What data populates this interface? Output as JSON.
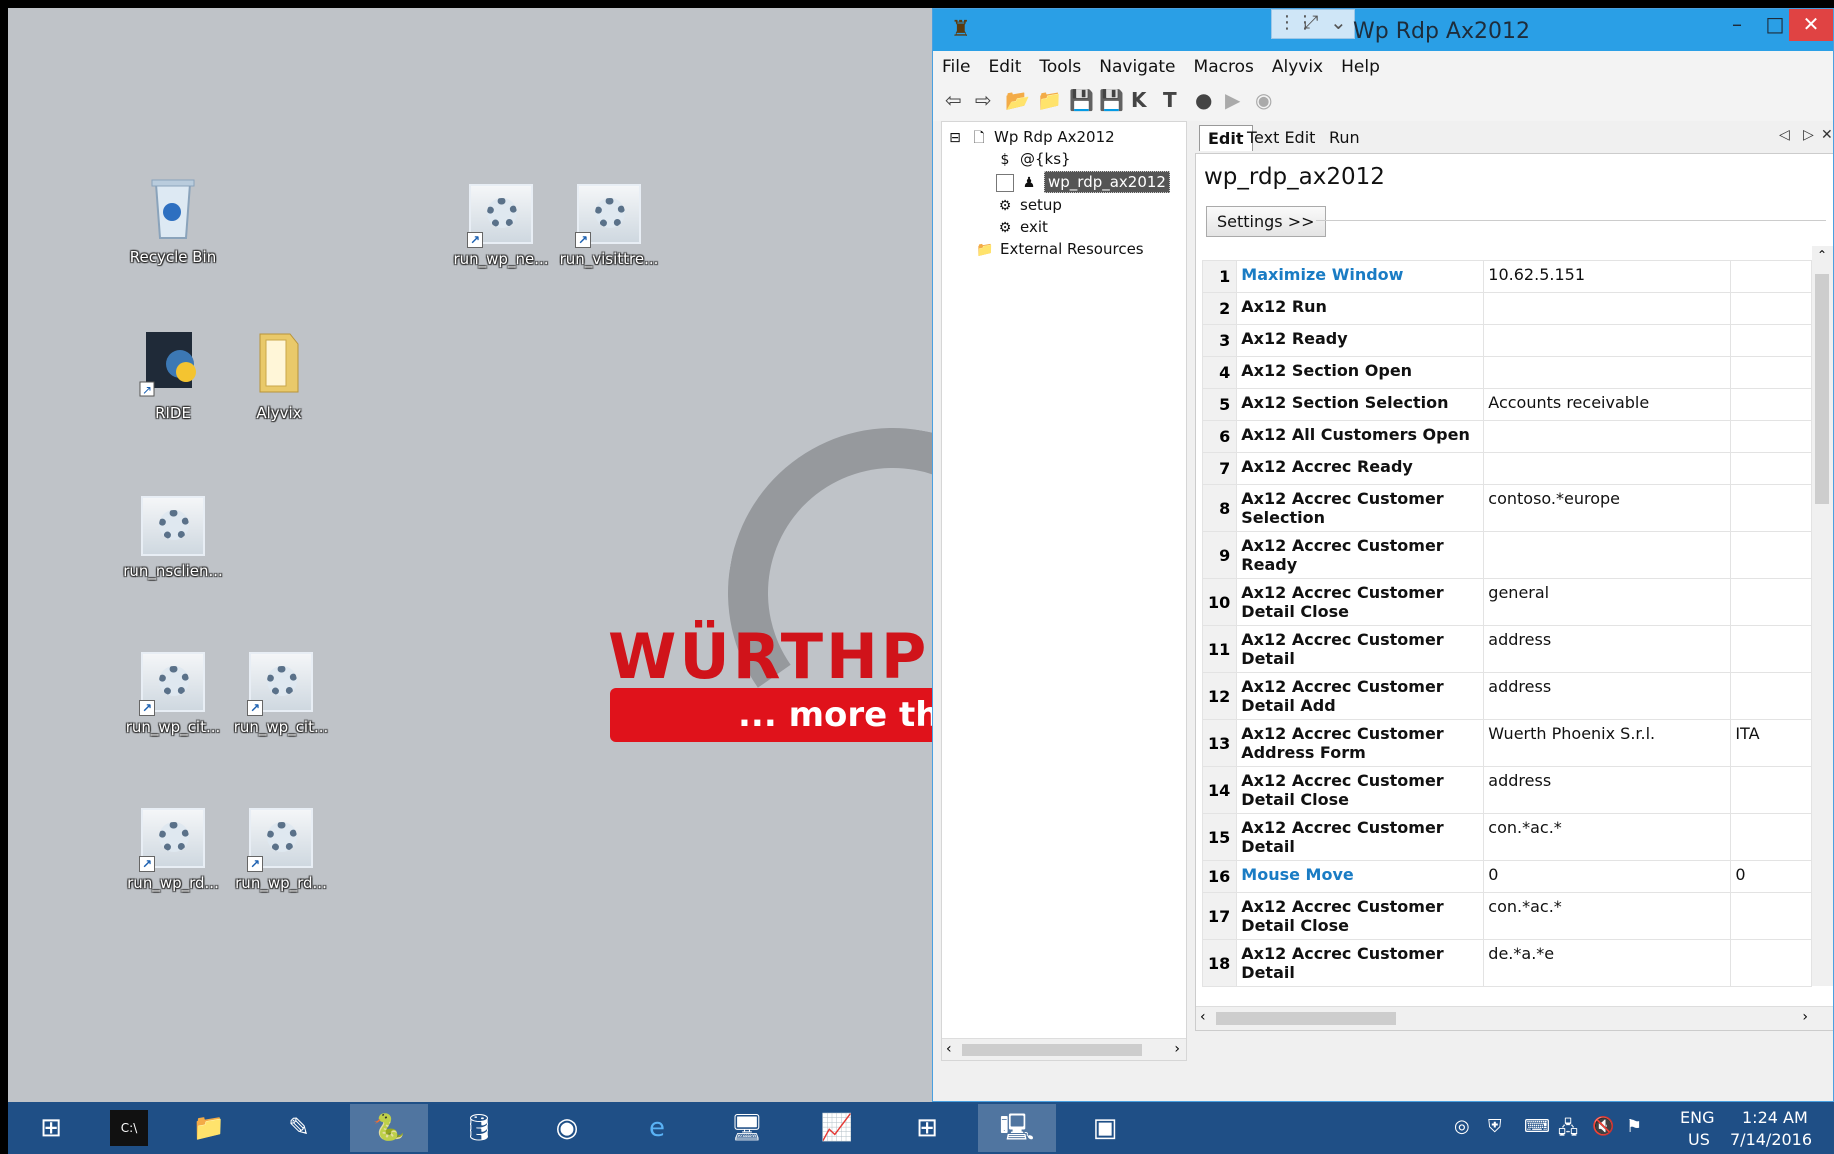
{
  "desktop": {
    "icons": [
      {
        "label": "Recycle Bin"
      },
      {
        "label": "run_wp_ne..."
      },
      {
        "label": "run_visittre..."
      },
      {
        "label": "RIDE"
      },
      {
        "label": "Alyvix"
      },
      {
        "label": "run_nsclien..."
      },
      {
        "label": "run_wp_cit..."
      },
      {
        "label": "run_wp_cit..."
      },
      {
        "label": "run_wp_rd..."
      },
      {
        "label": "run_wp_rd..."
      }
    ],
    "wallpaper": {
      "brand_text": "WÜRTHP",
      "tagline": "... more tha",
      "brand_color": "#d0131a"
    }
  },
  "app": {
    "title": "Wp Rdp Ax2012",
    "window_controls": {
      "minimize": "–",
      "maximize": "□",
      "close": "✕"
    },
    "menu": [
      "File",
      "Edit",
      "Tools",
      "Navigate",
      "Macros",
      "Alyvix",
      "Help"
    ],
    "toolbar": [
      "back-arrow-icon",
      "forward-arrow-icon",
      "open-folder-icon",
      "folder-icon",
      "save-icon",
      "save-all-icon",
      "keyword-icon",
      "test-icon",
      "alyvix-icon",
      "run-icon",
      "stop-icon"
    ],
    "tree": {
      "root": "Wp Rdp Ax2012",
      "items": [
        {
          "label": "@{ks}",
          "icon": "variable-icon"
        },
        {
          "label": "wp_rdp_ax2012",
          "icon": "test-case-icon",
          "selected": true
        },
        {
          "label": "setup",
          "icon": "gear-icon"
        },
        {
          "label": "exit",
          "icon": "gear-icon"
        }
      ],
      "external": "External Resources"
    },
    "tabs": [
      "Edit",
      "Text Edit",
      "Run"
    ],
    "active_tab": "Edit",
    "editor": {
      "title": "wp_rdp_ax2012",
      "settings_label": "Settings >>",
      "rows": [
        {
          "n": "1",
          "keyword": "Maximize Window",
          "arg1": "10.62.5.151",
          "arg2": "",
          "builtin": true
        },
        {
          "n": "2",
          "keyword": "Ax12 Run",
          "arg1": "",
          "arg2": ""
        },
        {
          "n": "3",
          "keyword": "Ax12 Ready",
          "arg1": "",
          "arg2": ""
        },
        {
          "n": "4",
          "keyword": "Ax12 Section Open",
          "arg1": "",
          "arg2": ""
        },
        {
          "n": "5",
          "keyword": "Ax12 Section Selection",
          "arg1": "Accounts receivable",
          "arg2": ""
        },
        {
          "n": "6",
          "keyword": "Ax12 All Customers Open",
          "arg1": "",
          "arg2": ""
        },
        {
          "n": "7",
          "keyword": "Ax12 Accrec Ready",
          "arg1": "",
          "arg2": ""
        },
        {
          "n": "8",
          "keyword": "Ax12 Accrec Customer Selection",
          "arg1": "contoso.*europe",
          "arg2": ""
        },
        {
          "n": "9",
          "keyword": "Ax12 Accrec Customer Ready",
          "arg1": "",
          "arg2": ""
        },
        {
          "n": "10",
          "keyword": "Ax12 Accrec Customer Detail Close",
          "arg1": "general",
          "arg2": ""
        },
        {
          "n": "11",
          "keyword": "Ax12 Accrec Customer Detail",
          "arg1": "address",
          "arg2": ""
        },
        {
          "n": "12",
          "keyword": "Ax12 Accrec Customer Detail Add",
          "arg1": "address",
          "arg2": ""
        },
        {
          "n": "13",
          "keyword": "Ax12 Accrec Customer Address Form",
          "arg1": "Wuerth Phoenix S.r.l.",
          "arg2": "ITA"
        },
        {
          "n": "14",
          "keyword": "Ax12 Accrec Customer Detail Close",
          "arg1": "address",
          "arg2": ""
        },
        {
          "n": "15",
          "keyword": "Ax12 Accrec Customer Detail",
          "arg1": "con.*ac.*",
          "arg2": ""
        },
        {
          "n": "16",
          "keyword": "Mouse Move",
          "arg1": "0",
          "arg2": "0",
          "builtin": true
        },
        {
          "n": "17",
          "keyword": "Ax12 Accrec Customer Detail Close",
          "arg1": "con.*ac.*",
          "arg2": ""
        },
        {
          "n": "18",
          "keyword": "Ax12 Accrec Customer Detail",
          "arg1": "de.*a.*e",
          "arg2": ""
        }
      ]
    }
  },
  "taskbar": {
    "apps": [
      "start-icon",
      "cmd-icon",
      "explorer-icon",
      "editor-icon",
      "python-icon",
      "database-icon",
      "chrome-icon",
      "ie-icon",
      "rdp-icon",
      "monitor-icon",
      "network-icon",
      "remote-desktop-icon",
      "window-icon"
    ],
    "tray": {
      "lang": "ENG",
      "region": "US",
      "time": "1:24 AM",
      "date": "7/14/2016"
    }
  }
}
